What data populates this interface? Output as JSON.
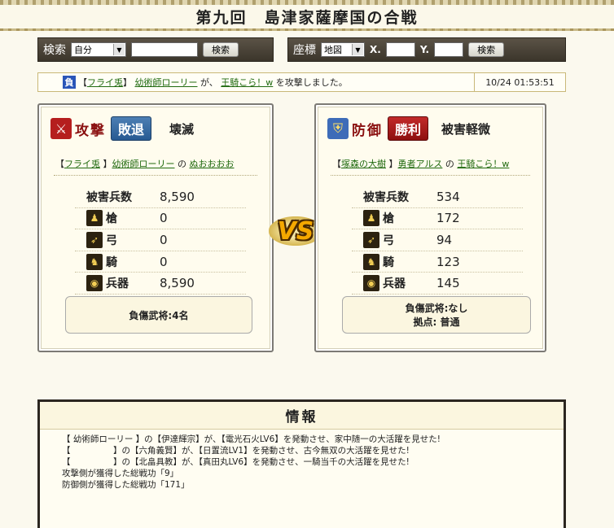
{
  "page": {
    "title": "第九回　島津家薩摩国の合戦"
  },
  "search_left": {
    "label": "検索",
    "select_value": "自分",
    "input_value": "",
    "button": "検索"
  },
  "search_right": {
    "label": "座標",
    "select_value": "地図",
    "x_label": "X.",
    "x_value": "",
    "y_label": "Y.",
    "y_value": "",
    "button": "検索"
  },
  "log": {
    "badge": "負",
    "bracket_open": "【",
    "attacker_alliance": "フライ兎",
    "bracket_close": "】",
    "attacker": "幼術師ローリー",
    "mid1": " が、",
    "target": "王騎こら！w",
    "mid2": " を攻撃しました。",
    "time": "10/24 01:53:51"
  },
  "attack": {
    "role_label": "攻撃",
    "result": "敗退",
    "damage_word": "壊滅",
    "alliance": "フライ兎",
    "player": "幼術師ローリー",
    "connector": " の ",
    "village": "ぬおおおお",
    "stats": {
      "troops_label": "被害兵数",
      "troops": "8,590",
      "spear_label": "槍",
      "spear": "0",
      "bow_label": "弓",
      "bow": "0",
      "horse_label": "騎",
      "horse": "0",
      "weapon_label": "兵器",
      "weapon": "8,590"
    },
    "casualty_line1": "負傷武将:4名",
    "casualty_line2": ""
  },
  "defense": {
    "role_label": "防御",
    "result": "勝利",
    "damage_word": "被害軽微",
    "alliance": "塚森の大樹",
    "player": "勇者アルス",
    "connector": " の ",
    "village": "王騎こら！w",
    "stats": {
      "troops_label": "被害兵数",
      "troops": "534",
      "spear_label": "槍",
      "spear": "172",
      "bow_label": "弓",
      "bow": "94",
      "horse_label": "騎",
      "horse": "123",
      "weapon_label": "兵器",
      "weapon": "145"
    },
    "casualty_line1": "負傷武将:なし",
    "casualty_line2": "拠点: 普通"
  },
  "vs_label": "VS",
  "info": {
    "title": "情報",
    "lines": [
      "【 幼術師ローリー 】の【伊達輝宗】が、【電光石火LV6】を発動させ、家中随一の大活躍を見せた!",
      "【　　　　　】の【六角義賢】が、【日置流LV1】を発動させ、古今無双の大活躍を見せた!",
      "【　　　　　】の【北畠具教】が、【真田丸LV6】を発動させ、一騎当千の大活躍を見せた!",
      "攻撃側が獲得した総戦功「9」",
      "防御側が獲得した総戦功「171」"
    ]
  },
  "colors": {
    "accent_red": "#8a1010",
    "lose_blue": "#275a92",
    "win_red": "#8e1010",
    "link_green": "#206a10"
  }
}
